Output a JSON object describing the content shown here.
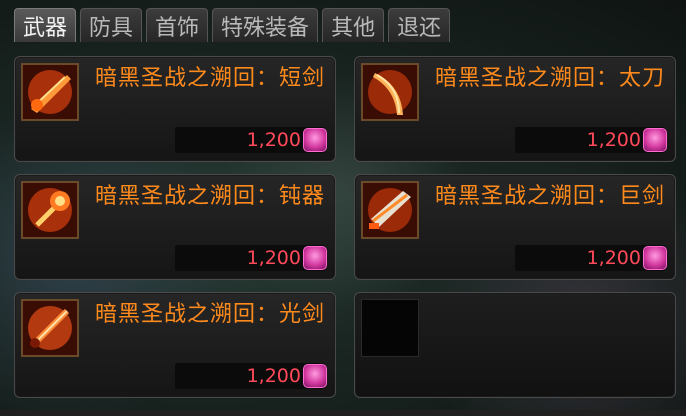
{
  "tabs": [
    {
      "label": "武器",
      "active": true
    },
    {
      "label": "防具",
      "active": false
    },
    {
      "label": "首饰",
      "active": false
    },
    {
      "label": "特殊装备",
      "active": false
    },
    {
      "label": "其他",
      "active": false
    },
    {
      "label": "退还",
      "active": false
    }
  ],
  "items": [
    {
      "name": "暗黑圣战之溯回：短剑",
      "price": "1,200",
      "icon": "short-sword-icon"
    },
    {
      "name": "暗黑圣战之溯回：太刀",
      "price": "1,200",
      "icon": "katana-icon"
    },
    {
      "name": "暗黑圣战之溯回：钝器",
      "price": "1,200",
      "icon": "blunt-weapon-icon"
    },
    {
      "name": "暗黑圣战之溯回：巨剑",
      "price": "1,200",
      "icon": "great-sword-icon"
    },
    {
      "name": "暗黑圣战之溯回：光剑",
      "price": "1,200",
      "icon": "lightsaber-icon"
    }
  ],
  "colors": {
    "item_name": "#ff8a1c",
    "price": "#ff4a5a",
    "currency": "#d43aa0"
  }
}
